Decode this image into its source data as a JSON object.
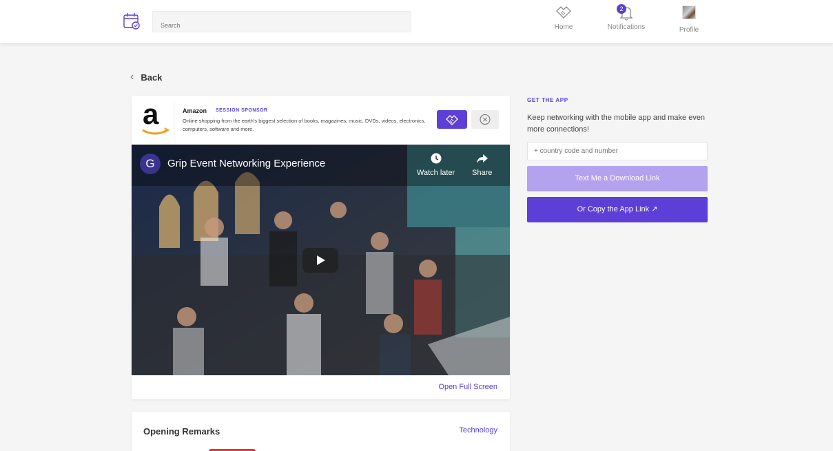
{
  "header": {
    "logo_icon": "calendar-check-icon",
    "search_placeholder": "Search",
    "nav": {
      "home": "Home",
      "notifications": "Notifications",
      "notifications_count": "2",
      "profile": "Profile"
    }
  },
  "back_label": "Back",
  "sponsor": {
    "name": "Amazon",
    "tag": "SESSION SPONSOR",
    "description": "Online shopping from the earth's biggest selection of books, magazines, music, DVDs, videos, electronics, computers, software and more."
  },
  "video": {
    "title": "Grip Event Networking Experience",
    "channel_initial": "G",
    "watch_later": "Watch later",
    "share": "Share"
  },
  "open_full_screen": "Open Full Screen",
  "session": {
    "title": "Opening Remarks",
    "tag": "Technology"
  },
  "get_app": {
    "heading": "GET THE APP",
    "text": "Keep networking with the mobile app and make even more connections!",
    "phone_placeholder": "+ country code and number",
    "text_me_label": "Text Me a Download Link",
    "copy_link_label": "Or Copy the App Link ↗"
  },
  "colors": {
    "accent": "#5b3fd6",
    "accent_light": "#b3a2ed"
  }
}
